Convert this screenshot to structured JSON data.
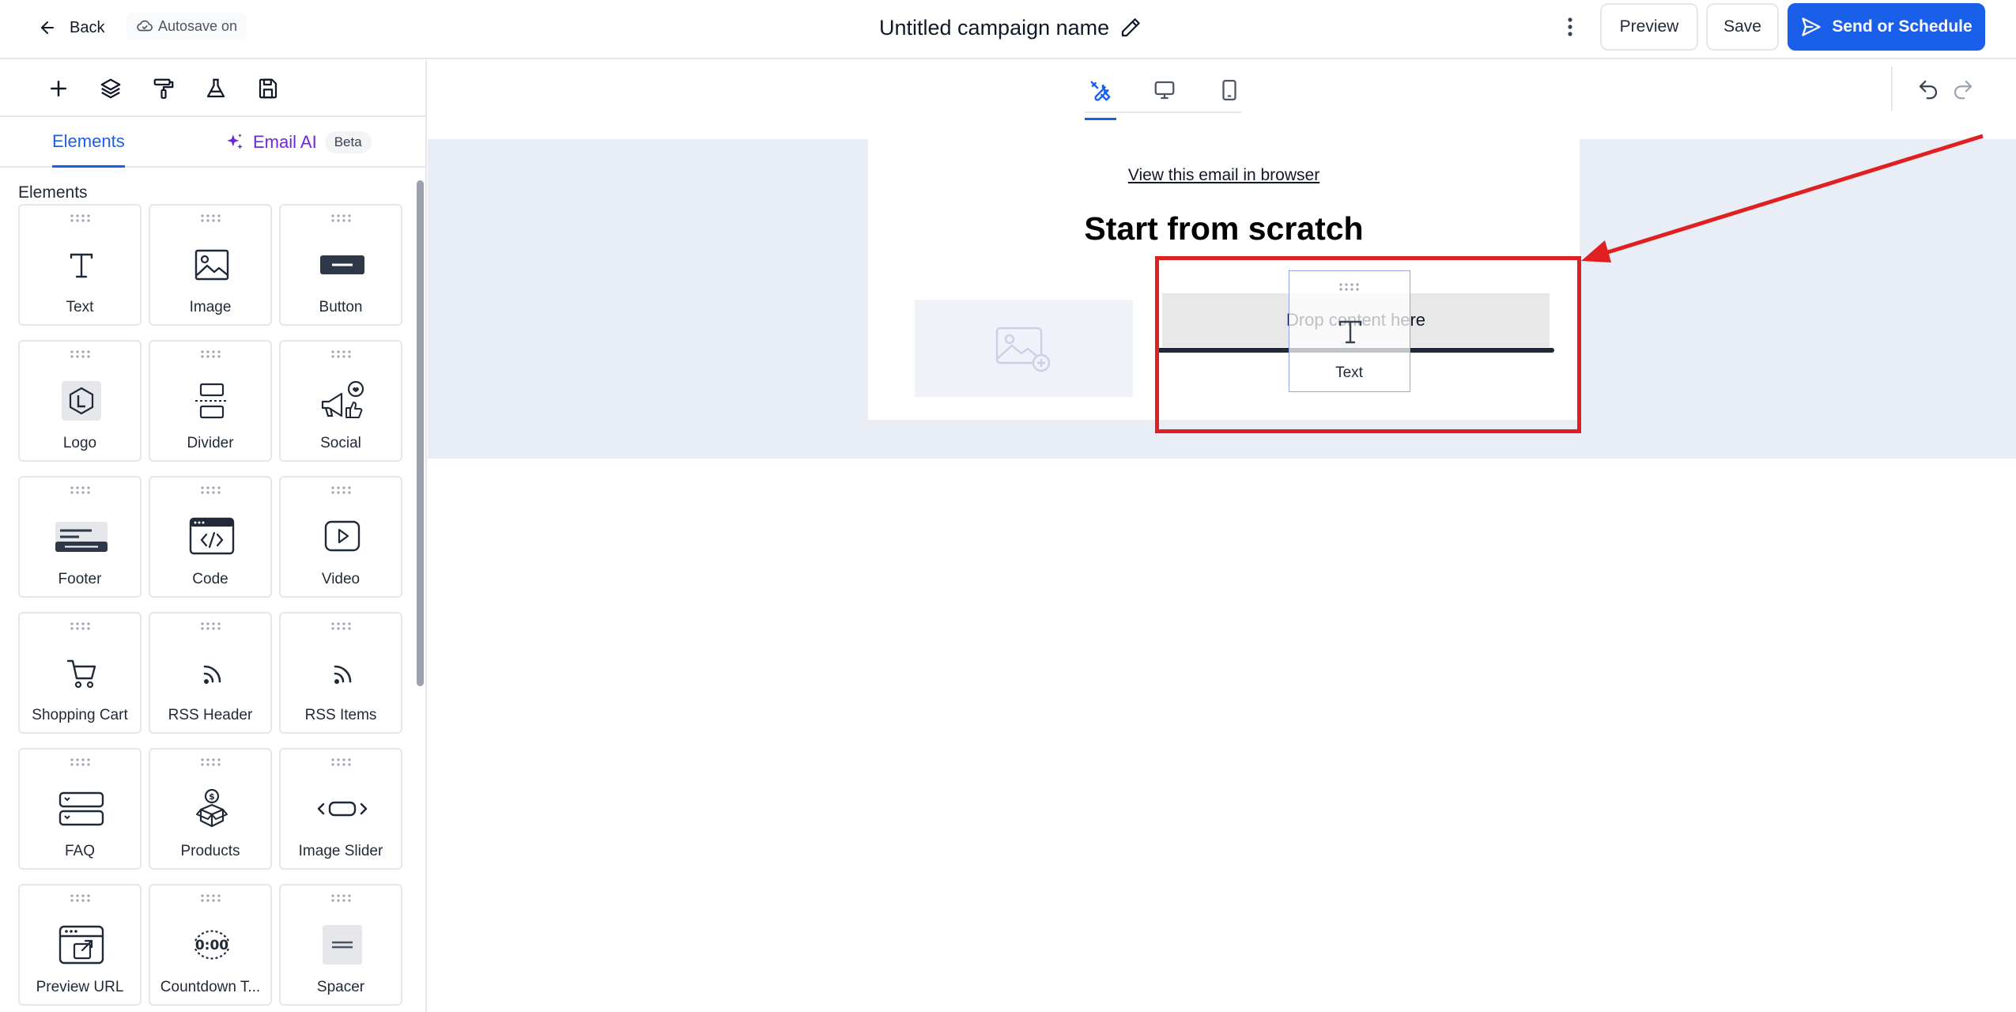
{
  "header": {
    "back_label": "Back",
    "autosave_label": "Autosave on",
    "campaign_name": "Untitled campaign name",
    "preview_label": "Preview",
    "save_label": "Save",
    "send_label": "Send or Schedule"
  },
  "sidebar": {
    "tools": [
      "add-icon",
      "layers-icon",
      "paint-roller-icon",
      "flask-icon",
      "save-icon"
    ],
    "tabs": {
      "elements": "Elements",
      "ai": "Email AI",
      "ai_badge": "Beta"
    },
    "section_title": "Elements",
    "elements": [
      {
        "label": "Text",
        "icon": "text-icon"
      },
      {
        "label": "Image",
        "icon": "image-icon"
      },
      {
        "label": "Button",
        "icon": "button-icon"
      },
      {
        "label": "Logo",
        "icon": "logo-icon"
      },
      {
        "label": "Divider",
        "icon": "divider-icon"
      },
      {
        "label": "Social",
        "icon": "social-icon"
      },
      {
        "label": "Footer",
        "icon": "footer-icon"
      },
      {
        "label": "Code",
        "icon": "code-icon"
      },
      {
        "label": "Video",
        "icon": "video-icon"
      },
      {
        "label": "Shopping Cart",
        "icon": "cart-icon"
      },
      {
        "label": "RSS Header",
        "icon": "rss-icon"
      },
      {
        "label": "RSS Items",
        "icon": "rss-icon"
      },
      {
        "label": "FAQ",
        "icon": "faq-icon"
      },
      {
        "label": "Products",
        "icon": "products-icon"
      },
      {
        "label": "Image Slider",
        "icon": "slider-icon"
      },
      {
        "label": "Preview URL",
        "icon": "preview-url-icon"
      },
      {
        "label": "Countdown T...",
        "icon": "countdown-icon"
      },
      {
        "label": "Spacer",
        "icon": "spacer-icon"
      }
    ]
  },
  "canvas": {
    "view_modes": [
      "builder",
      "desktop",
      "mobile"
    ],
    "active_view": "builder",
    "view_in_browser": "View this email in browser",
    "headline": "Start from scratch",
    "drop_text": "Drop content here",
    "drag_ghost_label": "Text"
  },
  "colors": {
    "accent": "#1a5fea",
    "ai": "#6d28d9",
    "annotation": "#e02020",
    "canvas_bg": "#e9edf5"
  }
}
